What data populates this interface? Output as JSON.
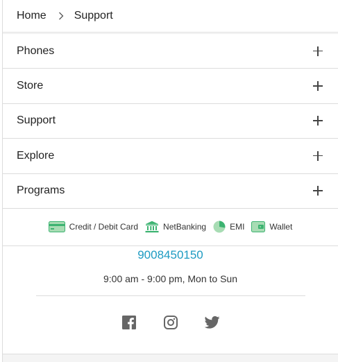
{
  "breadcrumb": {
    "home": "Home",
    "current": "Support"
  },
  "accordion": [
    {
      "label": "Phones"
    },
    {
      "label": "Store"
    },
    {
      "label": "Support"
    },
    {
      "label": "Explore"
    },
    {
      "label": "Programs"
    }
  ],
  "payments": [
    {
      "label": "Credit / Debit Card",
      "icon": "credit-card-icon"
    },
    {
      "label": "NetBanking",
      "icon": "bank-icon"
    },
    {
      "label": "EMI",
      "icon": "emi-pie-icon"
    },
    {
      "label": "Wallet",
      "icon": "wallet-icon"
    }
  ],
  "contact": {
    "phone": "9008450150",
    "hours": "9:00 am - 9:00 pm, Mon to Sun"
  },
  "social": [
    {
      "icon": "facebook-icon"
    },
    {
      "icon": "instagram-icon"
    },
    {
      "icon": "twitter-icon"
    }
  ],
  "colors": {
    "accent": "#1d9bc2",
    "payment_green": "#3cb371",
    "icon_gray": "#666666"
  }
}
